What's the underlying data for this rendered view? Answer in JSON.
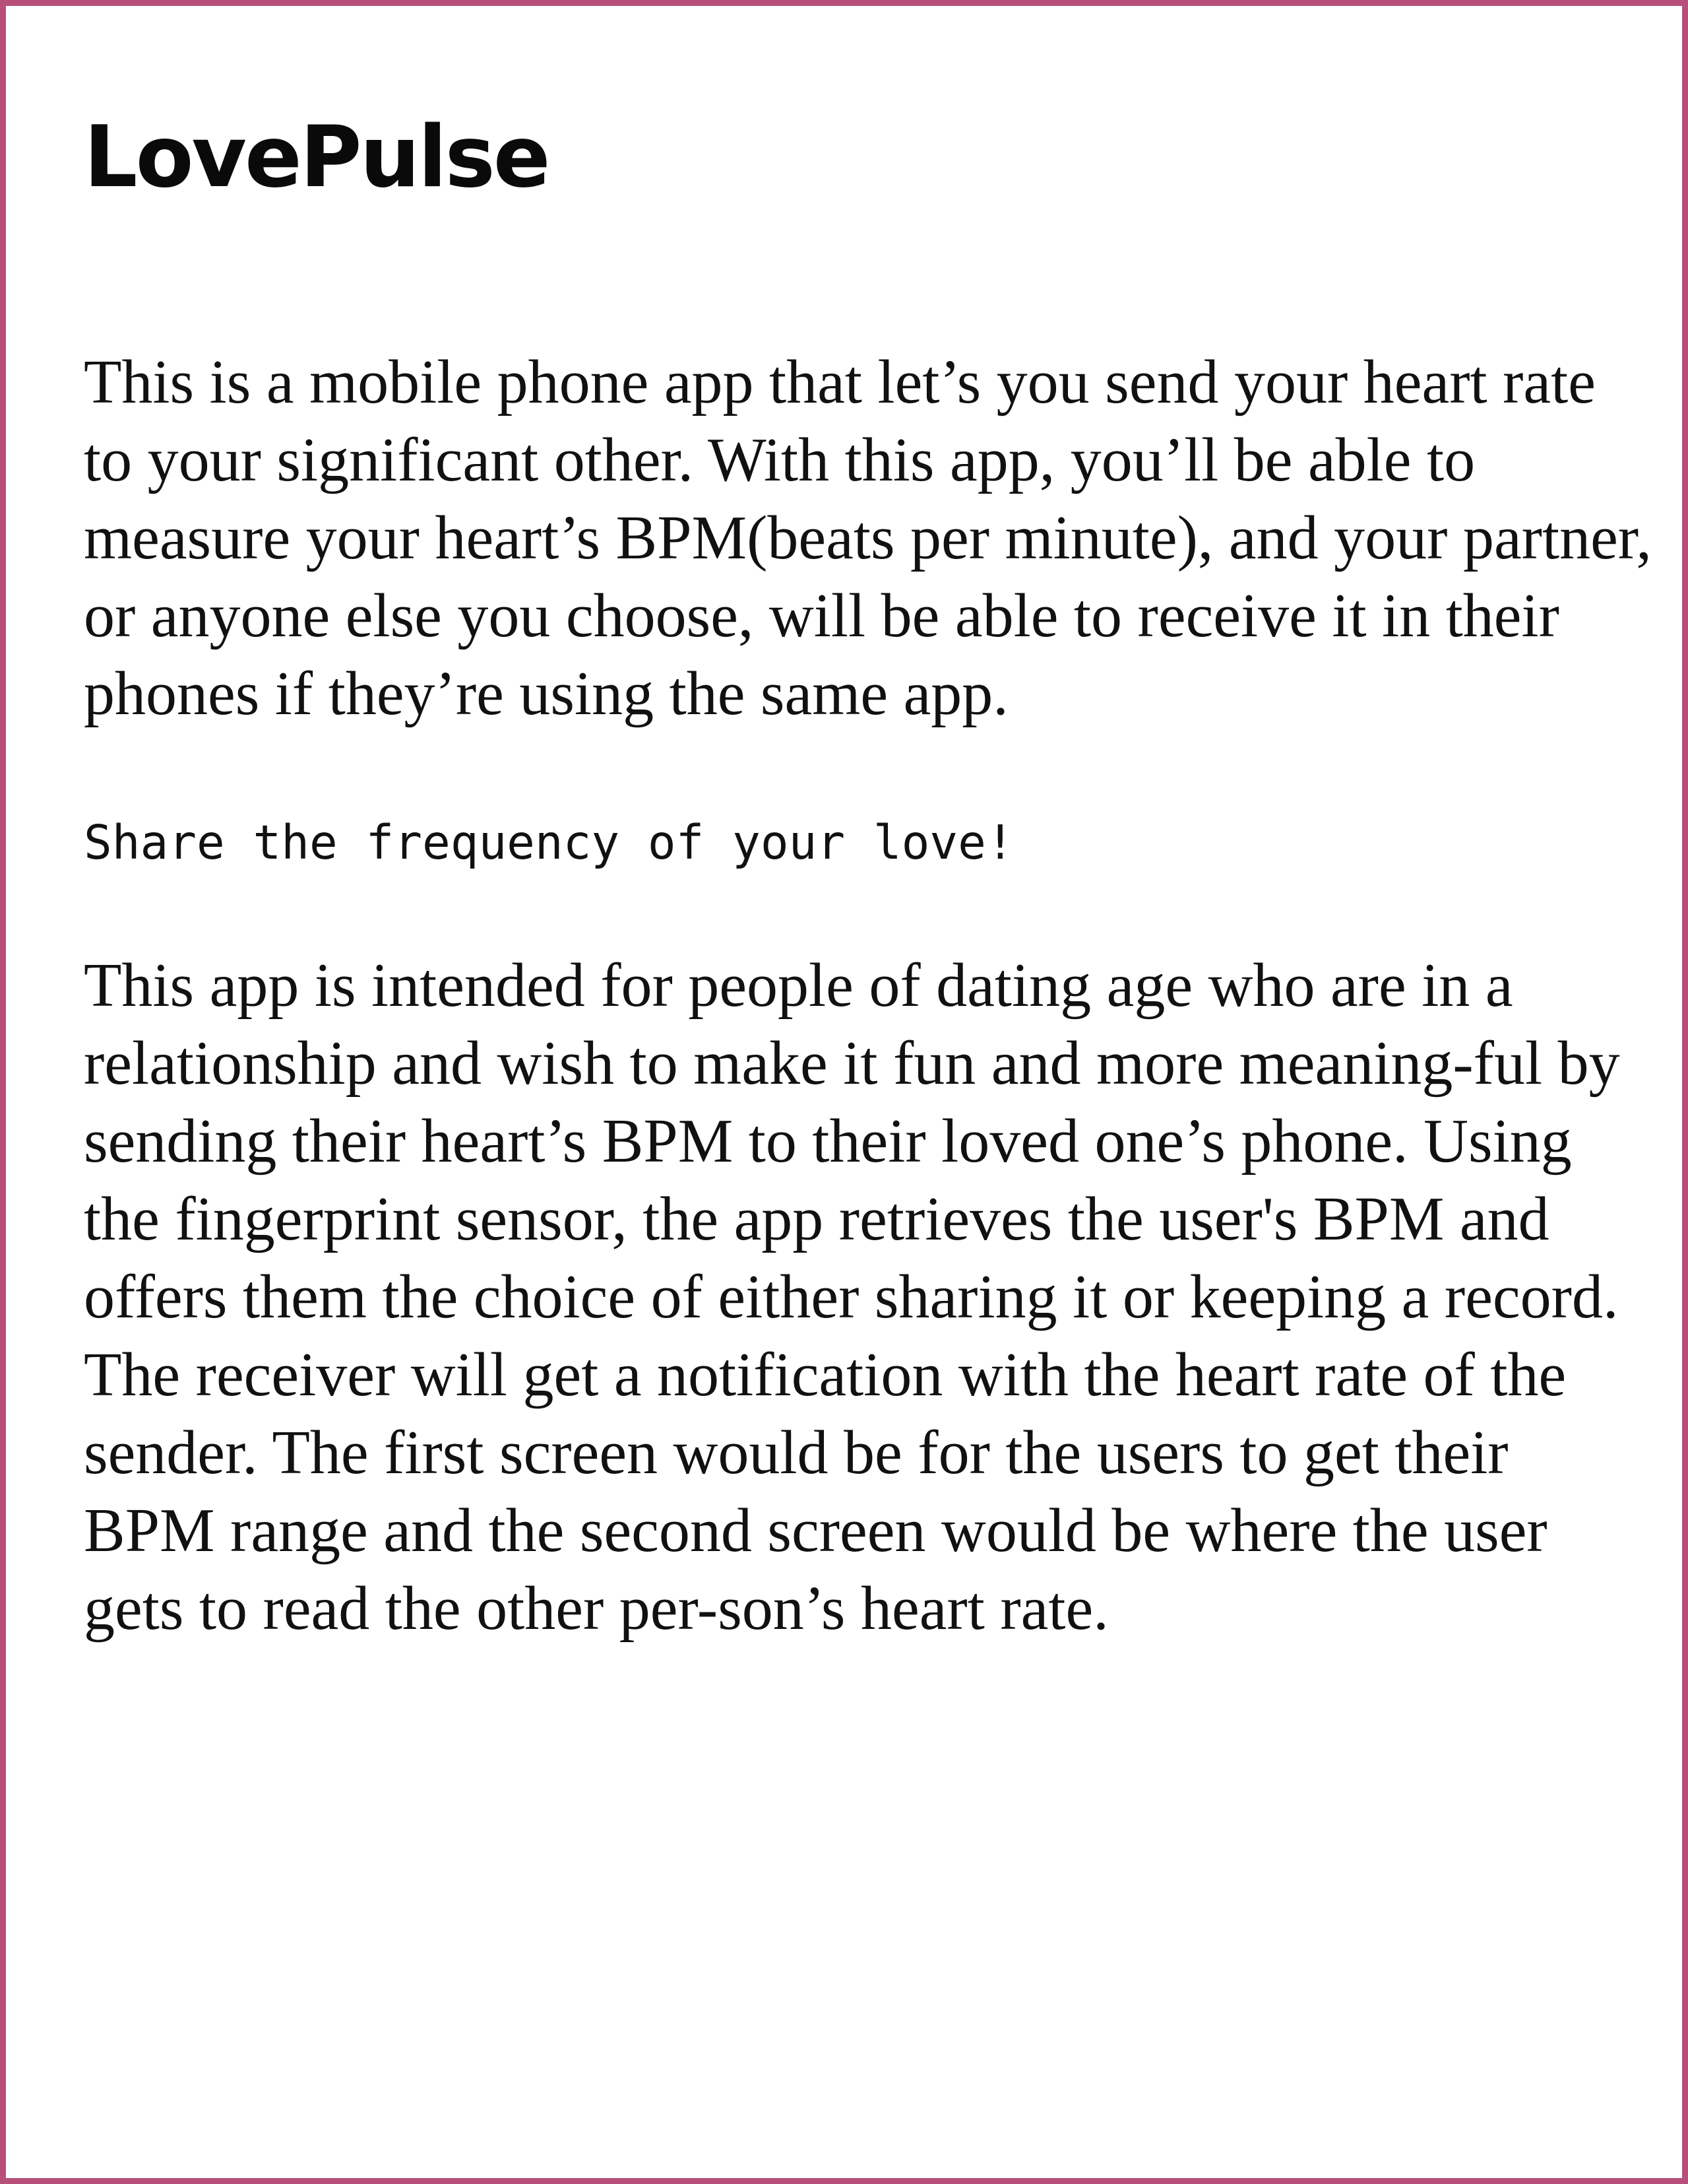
{
  "frame": {
    "border_color": "#b84f7b"
  },
  "document": {
    "title": "LovePulse",
    "intro_paragraph": "This is a mobile phone app that let’s you send your heart rate to your significant other. With this app, you’ll be able to measure your heart’s BPM(beats per minute), and your partner, or anyone else you choose, will be able to receive it in their phones if they’re using the same app.",
    "tagline": "Share the frequency of your love!",
    "description_paragraph": "This app is intended for people of dating age who are in a relationship and wish to make it fun and more meaning-ful by sending their heart’s BPM to their loved one’s phone. Using the fingerprint sensor, the app retrieves the user's BPM and offers them the choice of either sharing it or keeping a record. The receiver will get a notification with the heart rate of the sender. The first screen would be for the users to get their BPM range and the second screen would be where the user gets to read the other per-son’s heart rate."
  }
}
